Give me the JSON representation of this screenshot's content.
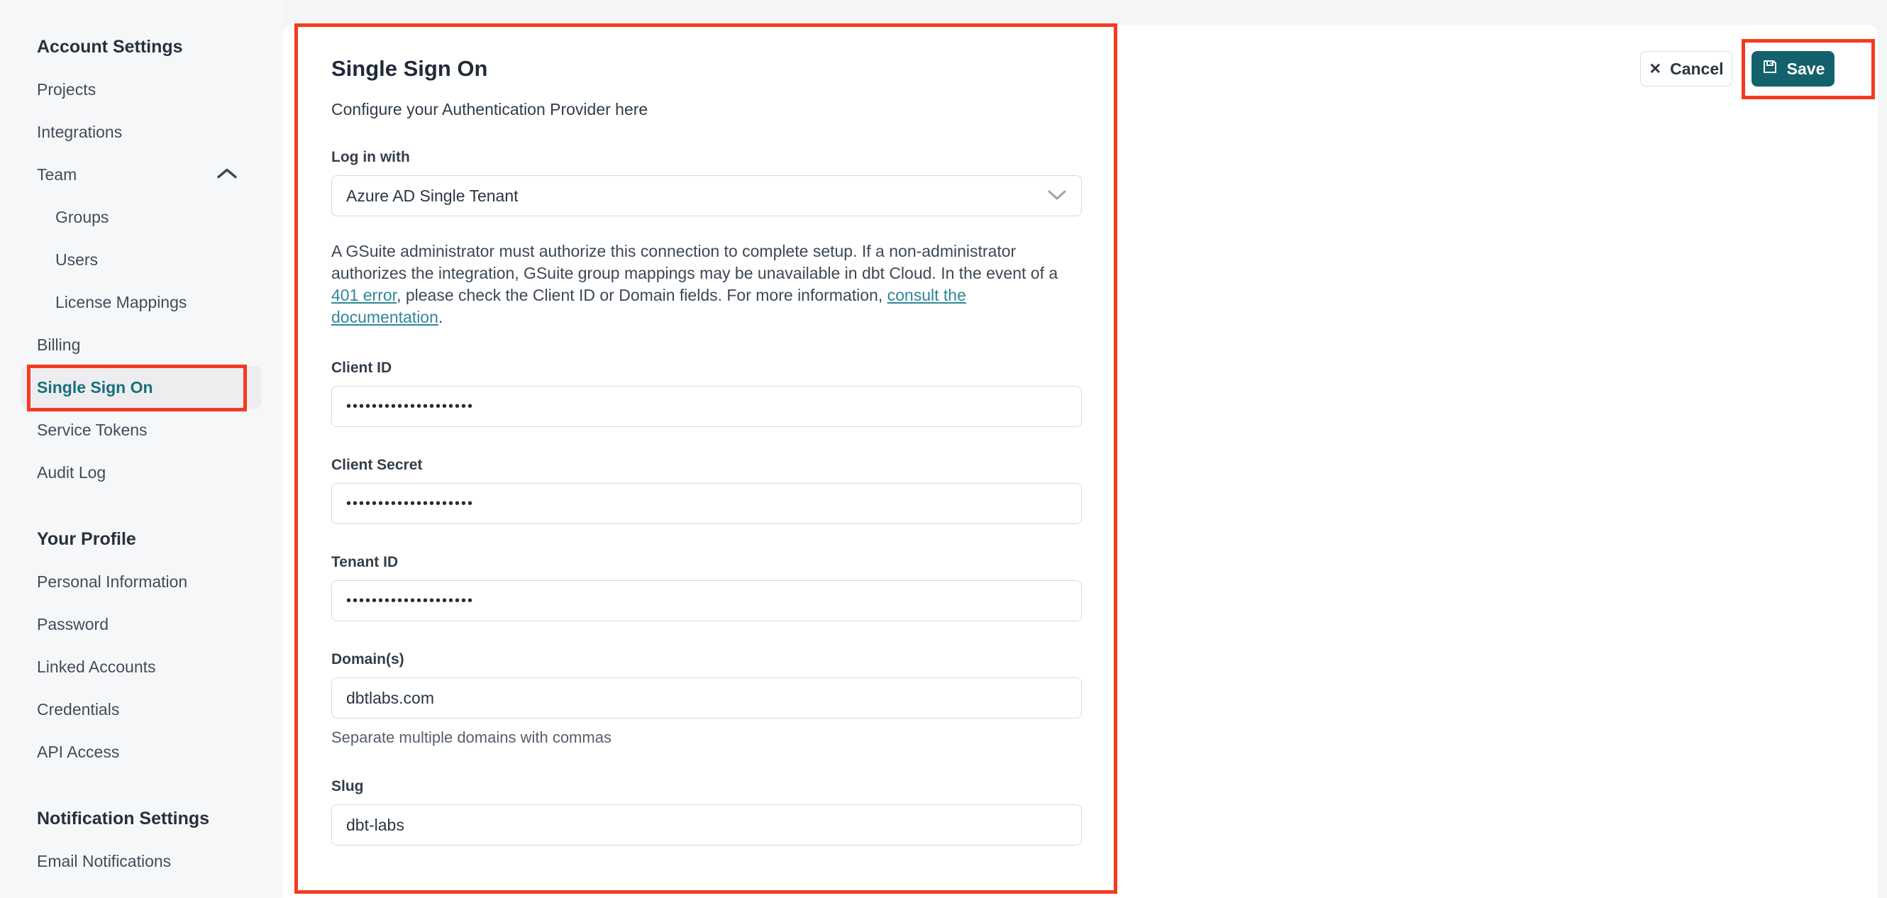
{
  "annotation": {
    "color": "#f43b20"
  },
  "sidebar": {
    "items": [
      {
        "label": "Account Settings",
        "type": "header"
      },
      {
        "label": "Projects",
        "type": "item"
      },
      {
        "label": "Integrations",
        "type": "item"
      },
      {
        "label": "Team",
        "type": "item",
        "expanded": true
      },
      {
        "label": "Groups",
        "type": "subitem"
      },
      {
        "label": "Users",
        "type": "subitem"
      },
      {
        "label": "License Mappings",
        "type": "subitem"
      },
      {
        "label": "Billing",
        "type": "item"
      },
      {
        "label": "Single Sign On",
        "type": "item",
        "active": true
      },
      {
        "label": "Service Tokens",
        "type": "item"
      },
      {
        "label": "Audit Log",
        "type": "item"
      },
      {
        "label": "Your Profile",
        "type": "header"
      },
      {
        "label": "Personal Information",
        "type": "item"
      },
      {
        "label": "Password",
        "type": "item"
      },
      {
        "label": "Linked Accounts",
        "type": "item"
      },
      {
        "label": "Credentials",
        "type": "item"
      },
      {
        "label": "API Access",
        "type": "item"
      },
      {
        "label": "Notification Settings",
        "type": "header"
      },
      {
        "label": "Email Notifications",
        "type": "item"
      }
    ],
    "active_item": "Single Sign On",
    "active_color": "#17707f"
  },
  "main": {
    "title": "Single Sign On",
    "subtitle": "Configure your Authentication Provider here",
    "login_with": {
      "label": "Log in with",
      "selected_value": "Azure AD Single Tenant"
    },
    "info": {
      "part1": "A GSuite administrator must authorize this connection to complete setup. If a non-administrator authorizes the integration, GSuite group mappings may be unavailable in dbt Cloud. In the event of a ",
      "link1": "401 error",
      "part2": ", please check the Client ID or Domain fields. For more information, ",
      "link2": "consult the documentation",
      "part3": "."
    },
    "fields": {
      "client_id": {
        "label": "Client ID",
        "value": "••••••••••••••••••••",
        "masked": true
      },
      "client_secret": {
        "label": "Client Secret",
        "value": "••••••••••••••••••••",
        "masked": true
      },
      "tenant_id": {
        "label": "Tenant ID",
        "value": "••••••••••••••••••••",
        "masked": true
      },
      "domains": {
        "label": "Domain(s)",
        "value": "dbtlabs.com",
        "helper": "Separate multiple domains with commas"
      },
      "slug": {
        "label": "Slug",
        "value": "dbt-labs"
      }
    }
  },
  "toolbar": {
    "cancel_label": "Cancel",
    "save_label": "Save",
    "save_color": "#13616d"
  }
}
